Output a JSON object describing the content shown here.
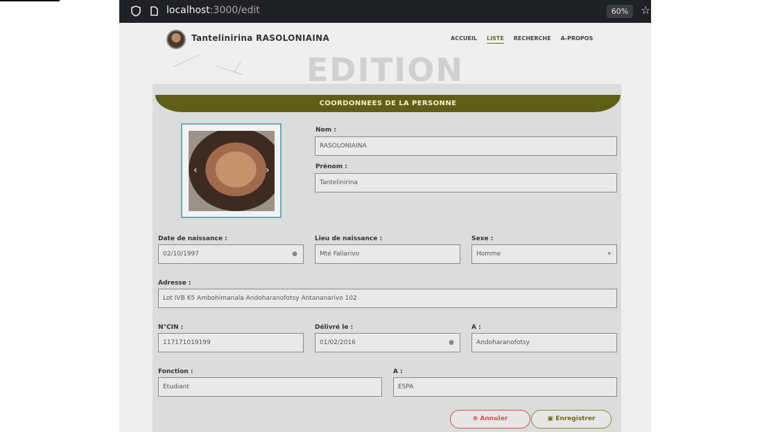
{
  "browser": {
    "url_host": "localhost",
    "url_path": ":3000/edit",
    "zoom": "60%"
  },
  "header": {
    "brand_name": "Tantelinirina RASOLONIAINA",
    "nav": [
      "ACCUEIL",
      "LISTE",
      "RECHERCHE",
      "A-PROPOS"
    ],
    "active_nav": "LISTE"
  },
  "page": {
    "title": "EDITION",
    "section_title": "COORDONNEES DE LA PERSONNE"
  },
  "form": {
    "nom_label": "Nom :",
    "nom_value": "RASOLONIAINA",
    "prenom_label": "Prénom :",
    "prenom_value": "Tantelinirina",
    "date_naissance_label": "Date de naissance :",
    "date_naissance_value": "02/10/1997",
    "lieu_naissance_label": "Lieu de naissance :",
    "lieu_naissance_value": "Mté Faliarivo",
    "sexe_label": "Sexe :",
    "sexe_value": "Homme",
    "adresse_label": "Adresse :",
    "adresse_value": "Lot IVB 65 Ambohimanala Andoharanofotsy Antananarivo 102",
    "cin_label": "N°CIN :",
    "cin_value": "117171019199",
    "delivre_label": "Délivré le :",
    "delivre_value": "01/02/2016",
    "a_cin_label": "A :",
    "a_cin_value": "Andoharanofotsy",
    "fonction_label": "Fonction :",
    "fonction_value": "Etudiant",
    "a_fonction_label": "A :",
    "a_fonction_value": "ESPA"
  },
  "buttons": {
    "cancel": "Annuler",
    "save": "Enregistrer"
  },
  "colors": {
    "accent": "#5f5e17",
    "cancel": "#d14f4f",
    "photo_border": "#6da9b3"
  }
}
